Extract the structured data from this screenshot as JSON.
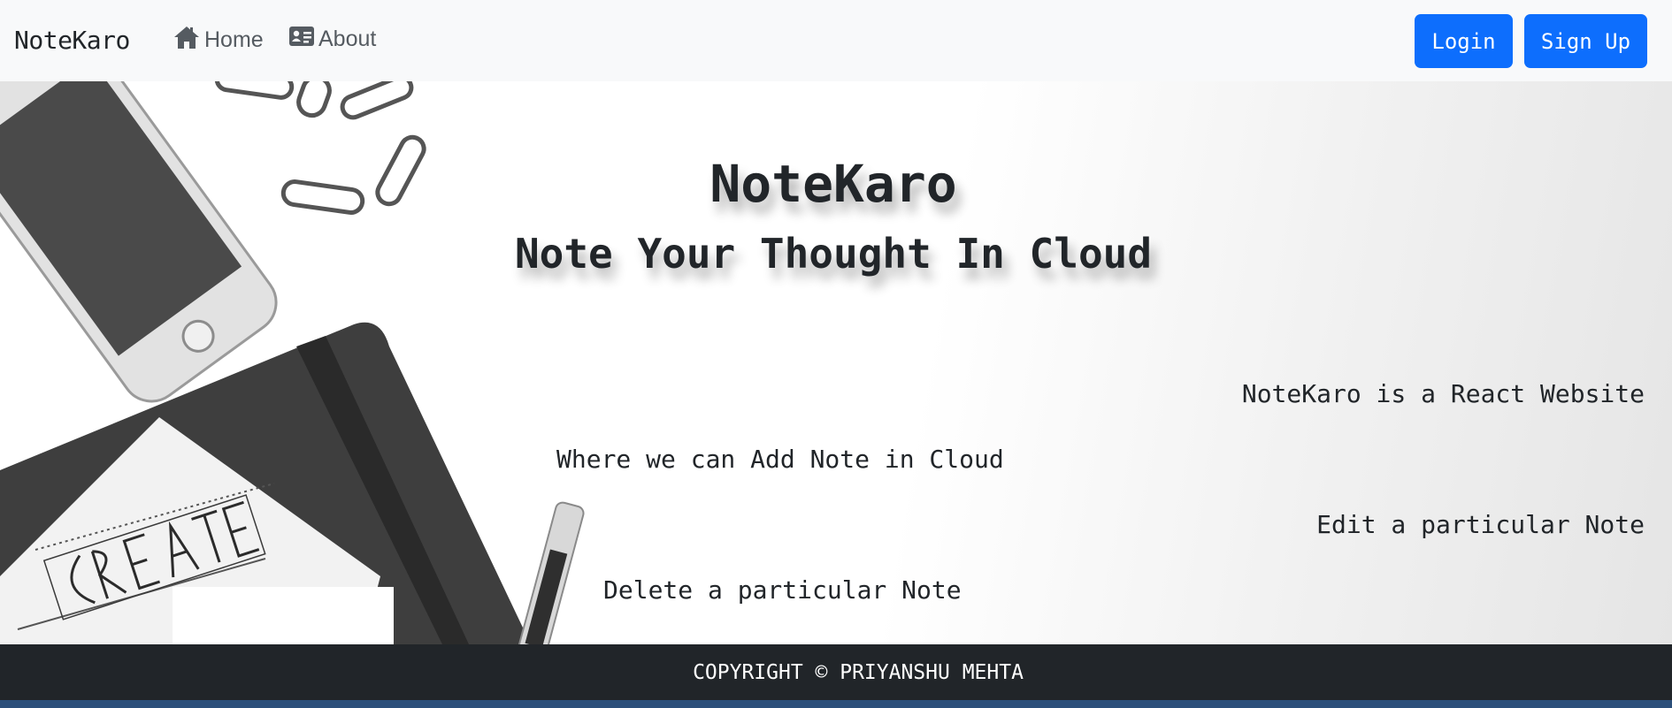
{
  "navbar": {
    "brand": "NoteKaro",
    "links": [
      {
        "label": "Home",
        "icon": "home-icon"
      },
      {
        "label": "About",
        "icon": "id-card-icon"
      }
    ],
    "login_label": "Login",
    "signup_label": "Sign Up",
    "accent_color": "#0d6efd"
  },
  "hero": {
    "title": "NoteKaro",
    "subtitle": "Note Your Thought In Cloud",
    "features": [
      "NoteKaro is a React Website",
      "Where we can Add Note in Cloud",
      "Edit a particular Note",
      "Delete a particular Note"
    ],
    "artwork_text": "CREATE"
  },
  "footer": {
    "copyright": "COPYRIGHT © PRIYANSHU MEHTA"
  }
}
